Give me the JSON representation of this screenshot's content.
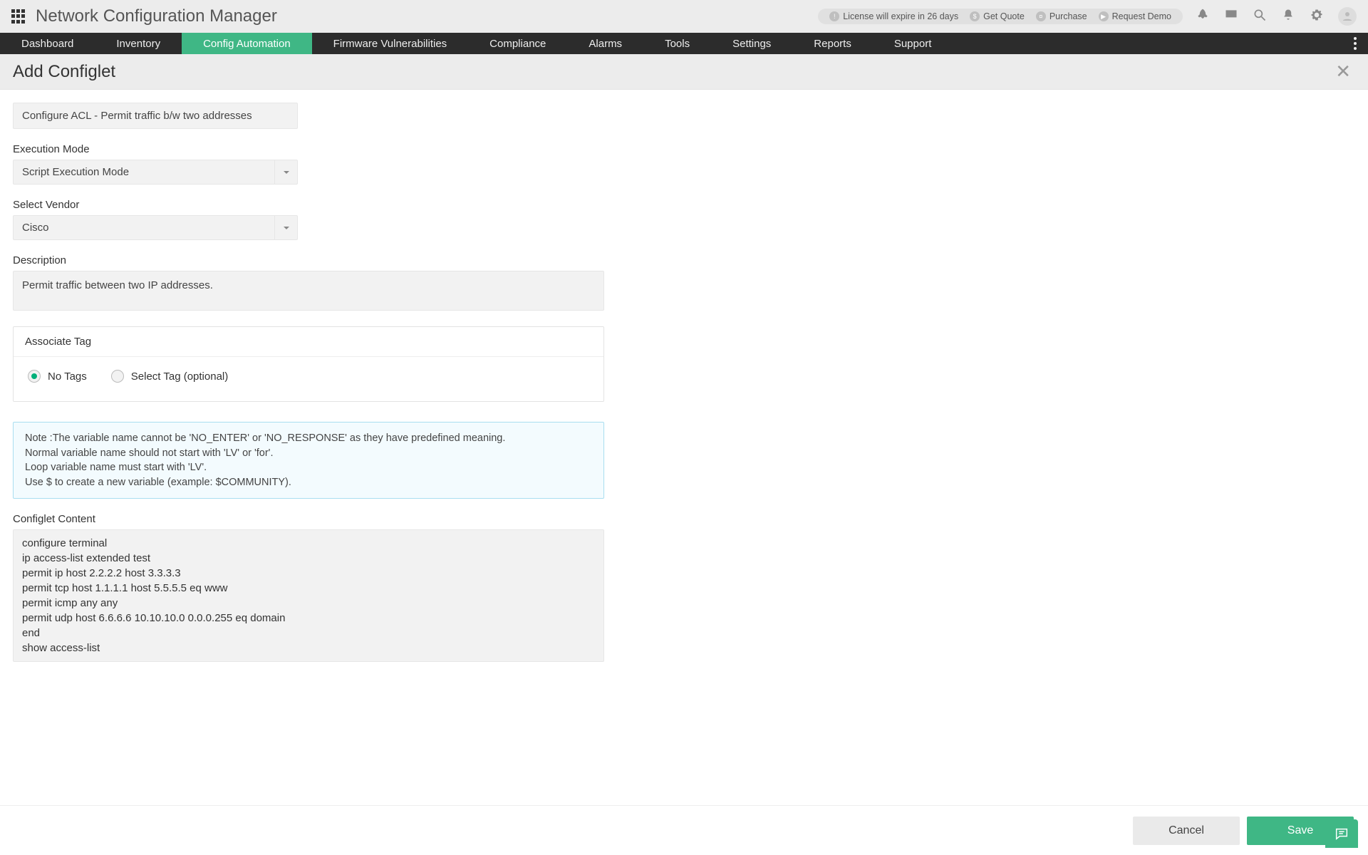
{
  "header": {
    "app_title": "Network Configuration Manager",
    "pills": {
      "license": "License will expire in 26 days",
      "quote": "Get Quote",
      "purchase": "Purchase",
      "demo": "Request Demo"
    }
  },
  "nav": {
    "items": [
      "Dashboard",
      "Inventory",
      "Config Automation",
      "Firmware Vulnerabilities",
      "Compliance",
      "Alarms",
      "Tools",
      "Settings",
      "Reports",
      "Support"
    ],
    "active_index": 2
  },
  "page": {
    "title": "Add Configlet"
  },
  "form": {
    "name_value": "Configure ACL - Permit traffic b/w two addresses",
    "exec_mode_label": "Execution Mode",
    "exec_mode_value": "Script Execution Mode",
    "vendor_label": "Select Vendor",
    "vendor_value": "Cisco",
    "description_label": "Description",
    "description_value": "Permit traffic between two IP addresses.",
    "associate_tag_label": "Associate Tag",
    "tag_options": {
      "no_tags": "No Tags",
      "select_tag": "Select Tag (optional)"
    },
    "tag_selected": "no_tags",
    "note_prefix": "Note :",
    "note_body": "The variable name cannot be 'NO_ENTER' or 'NO_RESPONSE' as they have predefined meaning.\nNormal variable name should not start with 'LV' or 'for'.\nLoop variable name must start with 'LV'.\nUse $ to create a new variable (example: $COMMUNITY).",
    "content_label": "Configlet Content",
    "content_value": "configure terminal\nip access-list extended test\npermit ip host 2.2.2.2 host 3.3.3.3\npermit tcp host 1.1.1.1 host 5.5.5.5 eq www\npermit icmp any any\npermit udp host 6.6.6.6 10.10.10.0 0.0.0.255 eq domain\nend\nshow access-list"
  },
  "footer": {
    "cancel": "Cancel",
    "save": "Save"
  },
  "colors": {
    "accent": "#3fb785",
    "nav_bg": "#2c2c2c",
    "header_bg": "#ececec",
    "note_border": "#a9def0",
    "note_bg": "#f3fbfe"
  }
}
